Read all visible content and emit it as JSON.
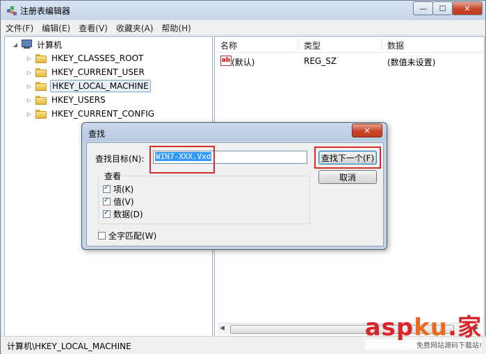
{
  "window": {
    "title": "注册表编辑器",
    "minimize": "—",
    "maximize": "☐",
    "close": "✕"
  },
  "menu": [
    "文件(F)",
    "编辑(E)",
    "查看(V)",
    "收藏夹(A)",
    "帮助(H)"
  ],
  "tree": {
    "root": "计算机",
    "items": [
      "HKEY_CLASSES_ROOT",
      "HKEY_CURRENT_USER",
      "HKEY_LOCAL_MACHINE",
      "HKEY_USERS",
      "HKEY_CURRENT_CONFIG"
    ],
    "selected_index": 2
  },
  "list": {
    "columns": [
      "名称",
      "类型",
      "数据"
    ],
    "rows": [
      {
        "icon": "ab",
        "name": "(默认)",
        "type": "REG_SZ",
        "data": "(数值未设置)"
      }
    ]
  },
  "status": "计算机\\HKEY_LOCAL_MACHINE",
  "dialog": {
    "title": "查找",
    "close": "✕",
    "find_label": "查找目标(N):",
    "find_value": "WIN7-XXX.Vxd",
    "find_next": "查找下一个(F)",
    "cancel": "取消",
    "look_at": "查看",
    "options": [
      {
        "label": "项(K)",
        "checked": true
      },
      {
        "label": "值(V)",
        "checked": true
      },
      {
        "label": "数据(D)",
        "checked": true
      }
    ],
    "match_whole": {
      "label": "全字匹配(W)",
      "checked": false
    }
  },
  "watermark": {
    "brand_a": "asp",
    "brand_b": "ku",
    "brand_c": ".家",
    "tagline": "免费网站源码下载站!"
  },
  "colors": {
    "highlight_box": "#d52b2b",
    "selection": "#3399ff"
  }
}
